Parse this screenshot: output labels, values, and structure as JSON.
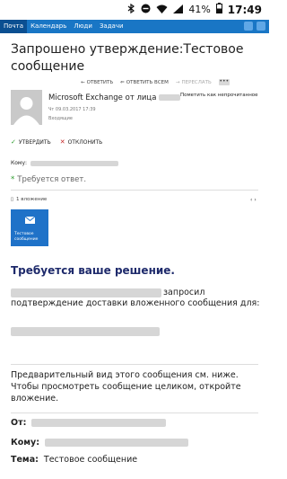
{
  "status_bar": {
    "battery": "41%",
    "clock": "17:49"
  },
  "nav": {
    "items": [
      {
        "label": "Почта",
        "active": true
      },
      {
        "label": "Календарь",
        "active": false
      },
      {
        "label": "Люди",
        "active": false
      },
      {
        "label": "Задачи",
        "active": false
      }
    ]
  },
  "message": {
    "subject": "Запрошено утверждение:Тестовое сообщение",
    "actions": {
      "reply": "ОТВЕТИТЬ",
      "reply_all": "ОТВЕТИТЬ ВСЕМ",
      "forward": "ПЕРЕСЛАТЬ",
      "more": "•••"
    },
    "sender_prefix": "Microsoft Exchange от лица",
    "sent_date": "Чт 09.03.2017 17:39",
    "folder": "Входящие",
    "mark_unread": "Пометить как непрочитанное",
    "approve": "УТВЕРДИТЬ",
    "reject": "ОТКЛОНИТЬ",
    "to_label": "Кому:",
    "response_required": "Требуется ответ.",
    "attachments_count": "1 вложение",
    "attachment_name": "Тестовое сообщение",
    "decision_heading": "Требуется ваше решение.",
    "body_line1_suffix": "запросил",
    "body_line2": "подтверждение доставки вложенного сообщения для:",
    "preview_note": "Предварительный вид этого сообщения см. ниже. Чтобы просмотреть сообщение целиком, откройте вложение.",
    "from_label": "От:",
    "to_label_2": "Кому:",
    "topic_label": "Тема:",
    "topic_value": "Тестовое сообщение"
  }
}
